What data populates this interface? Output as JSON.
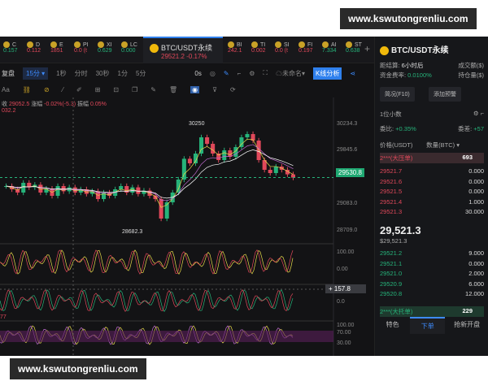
{
  "watermark": "www.kswutongrenliu.com",
  "tabs": [
    {
      "n": "C",
      "v": "0.157",
      "c": "green"
    },
    {
      "n": "D",
      "v": "0.112",
      "c": "red"
    },
    {
      "n": "E",
      "v": "1851",
      "c": "red"
    },
    {
      "n": "PI",
      "v": "0.0 (t",
      "c": "red"
    },
    {
      "n": "XI",
      "v": "0.629",
      "c": "green"
    },
    {
      "n": "LC",
      "v": "0.000",
      "c": "green"
    }
  ],
  "active_tab": {
    "title": "BTC/USDT永续",
    "price": "29521.2",
    "change": "-0.17%"
  },
  "tabs_right": [
    {
      "n": "BI",
      "v": "242.1",
      "c": "red"
    },
    {
      "n": "TI",
      "v": "0.002",
      "c": "red"
    },
    {
      "n": "SI",
      "v": "0.0 (t",
      "c": "red"
    },
    {
      "n": "FI",
      "v": "0.197",
      "c": "red"
    },
    {
      "n": "AI",
      "v": "7.334",
      "c": "green"
    },
    {
      "n": "ST",
      "v": "0.638",
      "c": "green"
    }
  ],
  "toolbar": {
    "replay": "复盘",
    "interval": "15分",
    "opts": [
      "1秒",
      "分时",
      "30秒",
      "1分",
      "5分"
    ],
    "countdown": "0s",
    "layout": "未命名",
    "analysis": "K线分析",
    "font": "Aa"
  },
  "info": {
    "close_label": "收",
    "close": "29052.5",
    "chg_label": "涨幅",
    "chg": "-0.02%(-5.3)",
    "amp_label": "振幅",
    "amp": "0.05%",
    "prev": "032.2"
  },
  "chart_data": {
    "type": "candlestick",
    "title": "BTC/USDT永续 15分",
    "y_ticks": [
      "30234.3",
      "29845.6",
      "29083.0",
      "28709.0"
    ],
    "current_price": "29530.8",
    "high_label": "30250",
    "low_label": "28682.3",
    "closes": [
      29400,
      29350,
      29300,
      29450,
      29380,
      29420,
      29300,
      29360,
      29250,
      29400,
      29320,
      29380,
      29300,
      29350,
      29280,
      29320,
      29200,
      29300,
      29250,
      29350,
      29400,
      29300,
      29380,
      29280,
      29330,
      29250,
      29200,
      28900,
      29150,
      29300,
      29500,
      29820,
      29750,
      29900,
      30150,
      30050,
      29900,
      29800,
      29950,
      29850,
      30000,
      30150,
      30200,
      30100,
      29800,
      29650,
      29600,
      29700,
      29650,
      29580,
      29530
    ],
    "ylim": [
      28600,
      30350
    ],
    "osc1_ticks": [
      "100.00",
      "0.00"
    ],
    "osc2_tick": "157.8",
    "osc2_zero": "0.0",
    "osc3_ticks": [
      "100.00",
      "70.00",
      "30.00"
    ],
    "osc2_label": "77"
  },
  "panel": {
    "title": "BTC/USDT永续",
    "k1": "距结算",
    "v1": "6小时后",
    "k2": "资金费率",
    "v2": "0.0100%",
    "k3": "成交额($)",
    "k4": "持仓量($)",
    "b1": "简况(F10)",
    "b2": "添加预警",
    "decimals": "1位小数",
    "ratio_label": "委比",
    "ratio": "+0.35%",
    "diff_label": "委差",
    "diff": "+57",
    "col_price": "价格(USDT)",
    "col_qty": "数量(BTC)",
    "big_ask": {
      "p": "2***(大压单)",
      "q": "693"
    },
    "asks": [
      {
        "p": "29521.7",
        "q": "0.000"
      },
      {
        "p": "29521.6",
        "q": "0.000"
      },
      {
        "p": "29521.5",
        "q": "0.000"
      },
      {
        "p": "29521.4",
        "q": "1.000"
      },
      {
        "p": "29521.3",
        "q": "30.000"
      }
    ],
    "last": "29,521.3",
    "last_usd": "$29,521.3",
    "bids": [
      {
        "p": "29521.2",
        "q": "9.000"
      },
      {
        "p": "29521.1",
        "q": "0.000"
      },
      {
        "p": "29521.0",
        "q": "2.000"
      },
      {
        "p": "29520.9",
        "q": "6.000"
      },
      {
        "p": "29520.8",
        "q": "12.000"
      }
    ],
    "big_bid": {
      "p": "2***(大托单)",
      "q": "229"
    },
    "bottom_tabs": [
      "特色",
      "下单",
      "抢新开盘"
    ]
  }
}
